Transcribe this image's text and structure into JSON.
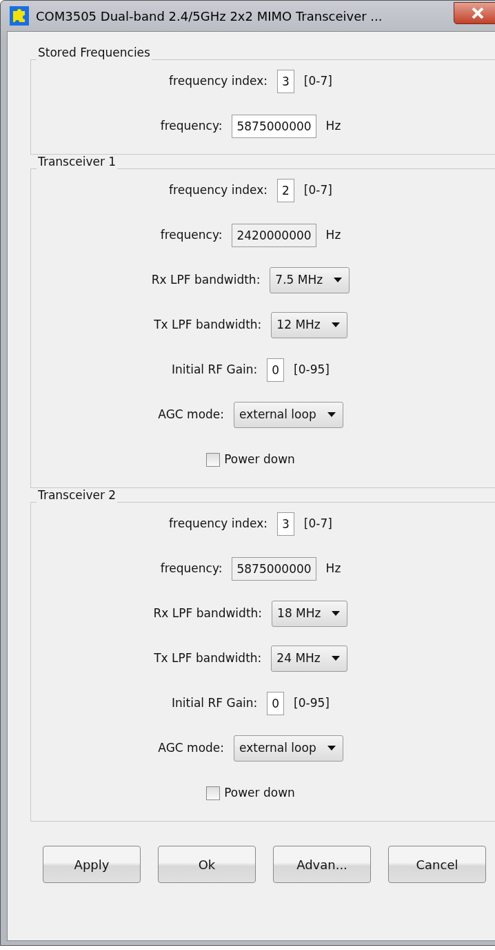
{
  "window": {
    "title": "COM3505 Dual-band 2.4/5GHz 2x2 MIMO Transceiver ..."
  },
  "groups": [
    {
      "title": "Stored Frequencies",
      "rows": [
        {
          "kind": "input",
          "label": "frequency index:",
          "value": "3",
          "suffix": "[0-7]",
          "disabled": false
        },
        {
          "kind": "input",
          "label": "frequency:",
          "value": "5875000000",
          "suffix": "Hz",
          "disabled": false
        }
      ]
    },
    {
      "title": "Transceiver 1",
      "rows": [
        {
          "kind": "input",
          "label": "frequency index:",
          "value": "2",
          "suffix": "[0-7]",
          "disabled": false
        },
        {
          "kind": "input",
          "label": "frequency:",
          "value": "2420000000",
          "suffix": "Hz",
          "disabled": true
        },
        {
          "kind": "dropdown",
          "label": "Rx LPF bandwidth:",
          "value": "7.5 MHz"
        },
        {
          "kind": "dropdown",
          "label": "Tx LPF bandwidth:",
          "value": "12 MHz"
        },
        {
          "kind": "input",
          "label": "Initial RF Gain:",
          "value": "0",
          "suffix": "[0-95]",
          "disabled": false
        },
        {
          "kind": "dropdown",
          "label": "AGC mode:",
          "value": "external loop"
        },
        {
          "kind": "checkbox",
          "label": "Power down",
          "checked": false
        }
      ]
    },
    {
      "title": "Transceiver 2",
      "rows": [
        {
          "kind": "input",
          "label": "frequency index:",
          "value": "3",
          "suffix": "[0-7]",
          "disabled": false
        },
        {
          "kind": "input",
          "label": "frequency:",
          "value": "5875000000",
          "suffix": "Hz",
          "disabled": true
        },
        {
          "kind": "dropdown",
          "label": "Rx LPF bandwidth:",
          "value": "18 MHz"
        },
        {
          "kind": "dropdown",
          "label": "Tx LPF bandwidth:",
          "value": "24 MHz"
        },
        {
          "kind": "input",
          "label": "Initial RF Gain:",
          "value": "0",
          "suffix": "[0-95]",
          "disabled": false
        },
        {
          "kind": "dropdown",
          "label": "AGC mode:",
          "value": "external loop"
        },
        {
          "kind": "checkbox",
          "label": "Power down",
          "checked": false
        }
      ]
    }
  ],
  "buttons": [
    "Apply",
    "Ok",
    "Advan...",
    "Cancel"
  ]
}
